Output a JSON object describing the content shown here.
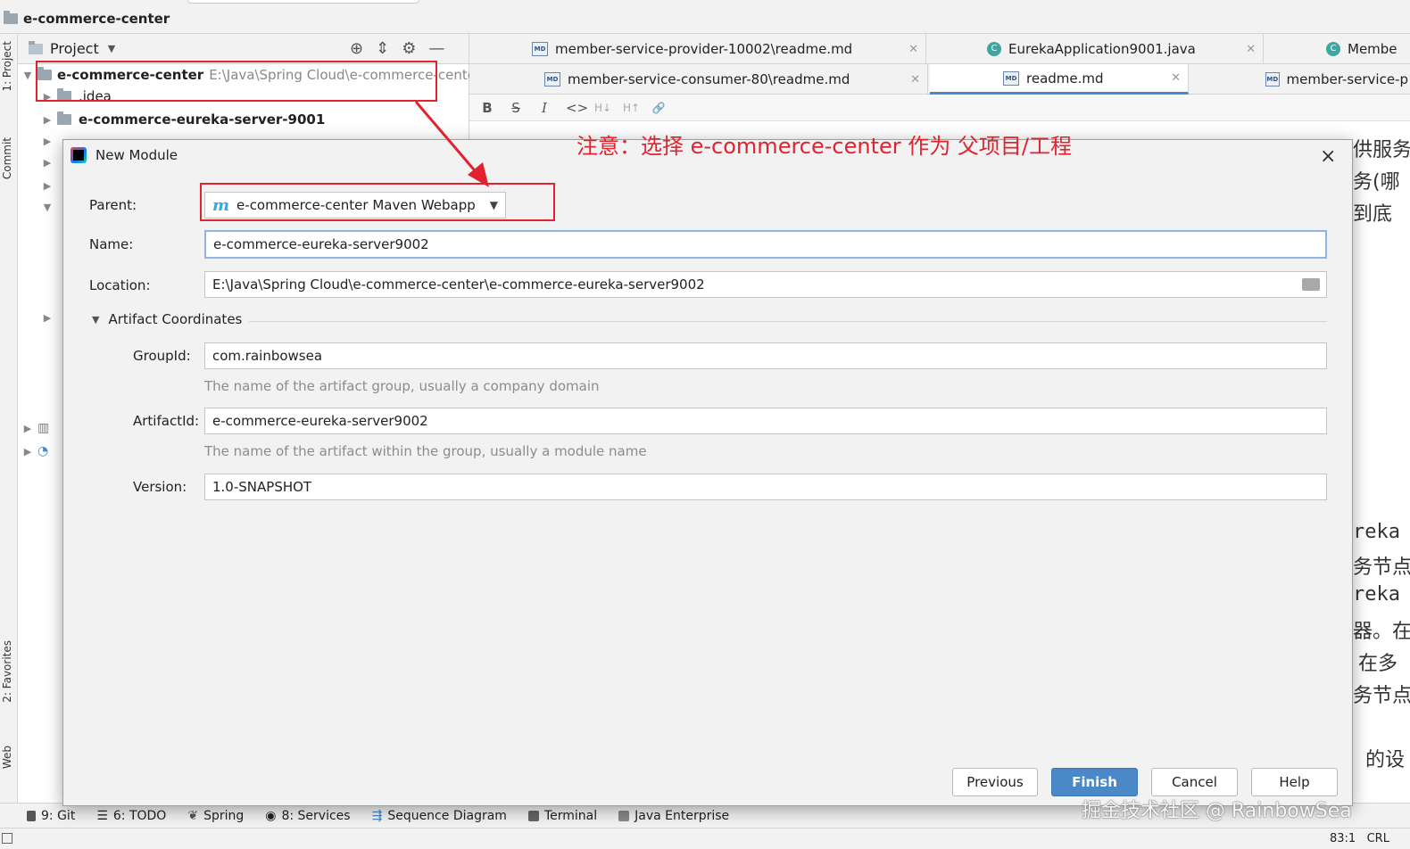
{
  "window": {
    "project_title": "e-commerce-center"
  },
  "sidebar_tabs": {
    "project": "1: Project",
    "commit": "Commit",
    "favorites": "2: Favorites",
    "web": "Web"
  },
  "project_panel": {
    "header": "Project",
    "root": {
      "name": "e-commerce-center",
      "path": "E:\\Java\\Spring Cloud\\e-commerce-center"
    },
    "items": [
      ".idea",
      "e-commerce-eureka-server-9001"
    ]
  },
  "editor_tabs_row1": [
    {
      "label": "member-service-provider-10002\\readme.md",
      "icon": "md-icon"
    },
    {
      "label": "EurekaApplication9001.java",
      "icon": "java-class-icon"
    },
    {
      "label": "Membe",
      "icon": "java-class-icon"
    }
  ],
  "editor_tabs_row2": [
    {
      "label": "member-service-consumer-80\\readme.md",
      "icon": "md-icon"
    },
    {
      "label": "readme.md",
      "icon": "md-icon",
      "active": true
    },
    {
      "label": "member-service-p",
      "icon": "md-icon"
    }
  ],
  "md_toolbar": [
    "B",
    "S",
    "I",
    "<>",
    "H↓",
    "H↑",
    "🔗"
  ],
  "preview_fragments": [
    "务(哪",
    "到底",
    "reka",
    "务节点",
    "reka",
    "器。在",
    "在多",
    "务节点",
    "的设",
    "供服务"
  ],
  "dialog": {
    "title": "New Module",
    "close": "×",
    "parent_label": "Parent:",
    "parent_value": "e-commerce-center Maven Webapp",
    "parent_icon": "m",
    "name_label": "Name:",
    "name_value": "e-commerce-eureka-server9002",
    "location_label": "Location:",
    "location_value": "E:\\Java\\Spring Cloud\\e-commerce-center\\e-commerce-eureka-server9002",
    "artifact_section": "Artifact Coordinates",
    "groupid_label": "GroupId:",
    "groupid_value": "com.rainbowsea",
    "groupid_hint": "The name of the artifact group, usually a company domain",
    "artifactid_label": "ArtifactId:",
    "artifactid_value": "e-commerce-eureka-server9002",
    "artifactid_hint": "The name of the artifact within the group, usually a module name",
    "version_label": "Version:",
    "version_value": "1.0-SNAPSHOT",
    "buttons": {
      "previous": "Previous",
      "finish": "Finish",
      "cancel": "Cancel",
      "help": "Help"
    }
  },
  "statusbar": [
    {
      "label": "9: Git"
    },
    {
      "label": "6: TODO"
    },
    {
      "label": "Spring"
    },
    {
      "label": "8: Services"
    },
    {
      "label": "Sequence Diagram"
    },
    {
      "label": "Terminal"
    },
    {
      "label": "Java Enterprise"
    }
  ],
  "caret_position": "83:1",
  "line_sep": "CRL",
  "annotation": "注意：选择 e-commerce-center 作为 父项目/工程",
  "watermark": "掘金技术社区 @ RainbowSea",
  "colors": {
    "annotation_red": "#e0232f",
    "accent_blue": "#4a88c7"
  }
}
